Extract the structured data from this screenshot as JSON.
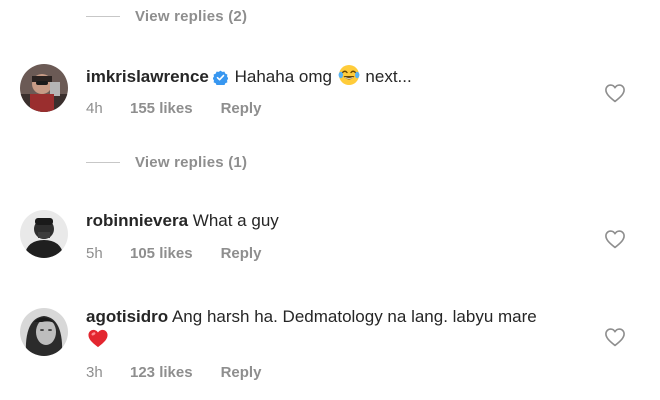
{
  "thread_top": {
    "view_replies_label": "View replies (2)"
  },
  "comments": [
    {
      "username": "imkrislawrence",
      "verified": true,
      "text": "Hahaha omg",
      "emoji": "face-with-tears-of-joy",
      "text_after_emoji": "next...",
      "time": "4h",
      "likes": "155 likes",
      "reply_label": "Reply",
      "view_replies_label": "View replies (1)"
    },
    {
      "username": "robinnievera",
      "verified": false,
      "text": "What a guy",
      "time": "5h",
      "likes": "105 likes",
      "reply_label": "Reply"
    },
    {
      "username": "agotisidro",
      "verified": false,
      "text": "Ang harsh ha. Dedmatology na lang. labyu mare",
      "emoji": "red-heart",
      "time": "3h",
      "likes": "123 likes",
      "reply_label": "Reply"
    }
  ],
  "icons": {
    "verified_badge": "verified-badge-icon",
    "like": "heart-outline-icon"
  },
  "colors": {
    "text_primary": "#262626",
    "text_secondary": "#8e8e8e",
    "verified_blue": "#3897f0",
    "divider": "#c7c7c7"
  }
}
